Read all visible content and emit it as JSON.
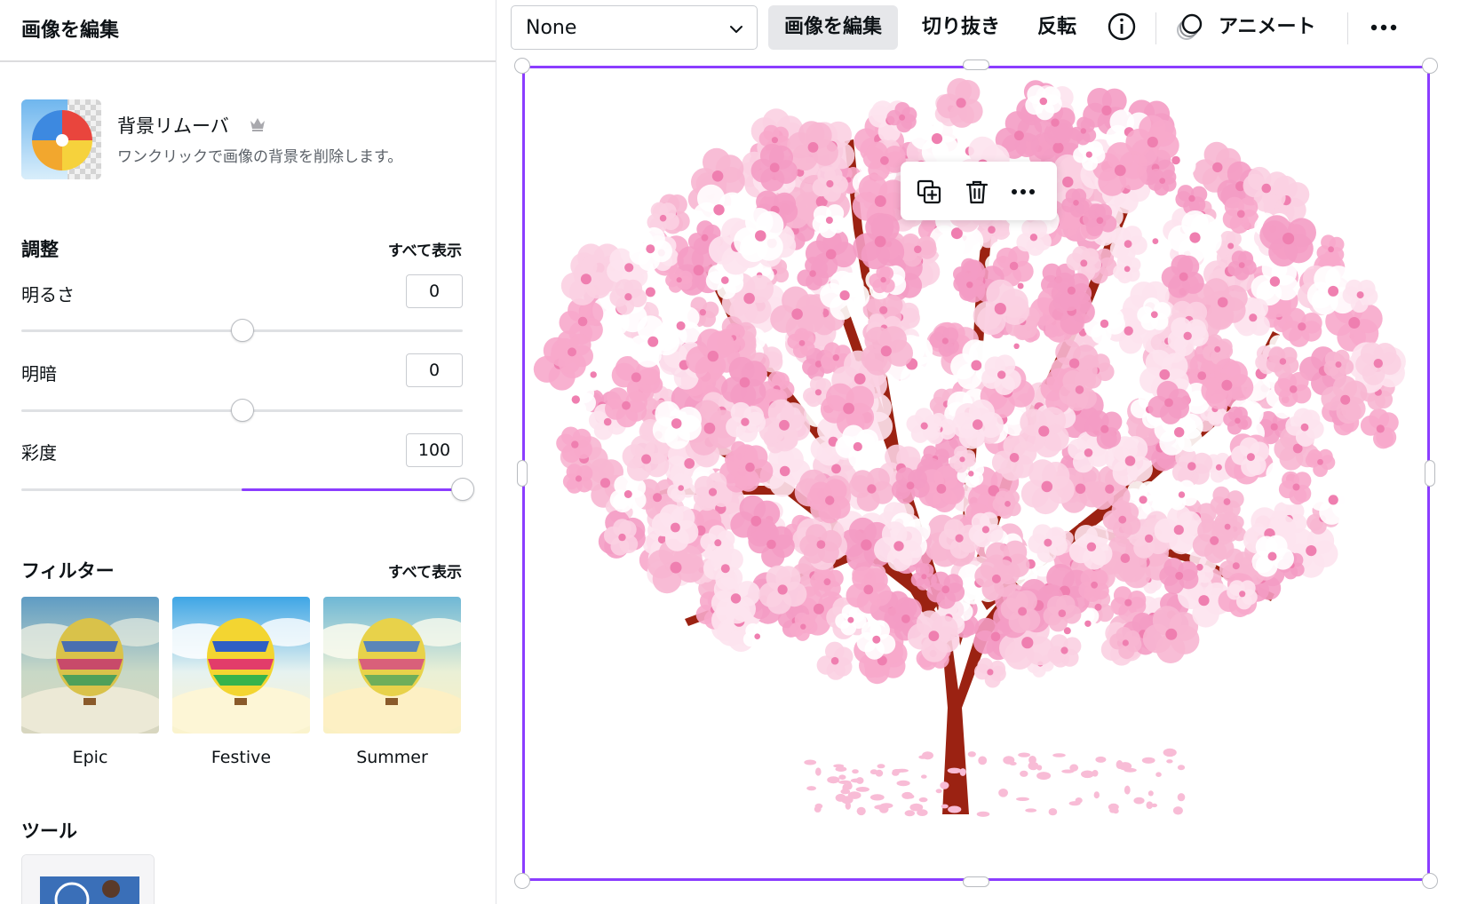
{
  "panel": {
    "title": "画像を編集",
    "bg_remover": {
      "title": "背景リムーバ",
      "description": "ワンクリックで画像の背景を削除します。"
    },
    "adjust": {
      "title": "調整",
      "see_all": "すべて表示",
      "items": [
        {
          "label": "明るさ",
          "value": "0"
        },
        {
          "label": "明暗",
          "value": "0"
        },
        {
          "label": "彩度",
          "value": "100"
        }
      ]
    },
    "filters": {
      "title": "フィルター",
      "see_all": "すべて表示",
      "items": [
        {
          "label": "Epic"
        },
        {
          "label": "Festive"
        },
        {
          "label": "Summer"
        }
      ]
    },
    "tools": {
      "title": "ツール"
    }
  },
  "toolbar": {
    "dropdown_value": "None",
    "edit_image": "画像を編集",
    "crop": "切り抜き",
    "flip": "反転",
    "animate": "アニメート"
  },
  "colors": {
    "accent": "#8b3dff",
    "blossom": "#f7b6d2",
    "trunk": "#9b2212"
  },
  "icons": [
    "chevron-down-icon",
    "info-icon",
    "animate-icon",
    "more-icon",
    "duplicate-icon",
    "trash-icon",
    "crown-icon"
  ]
}
